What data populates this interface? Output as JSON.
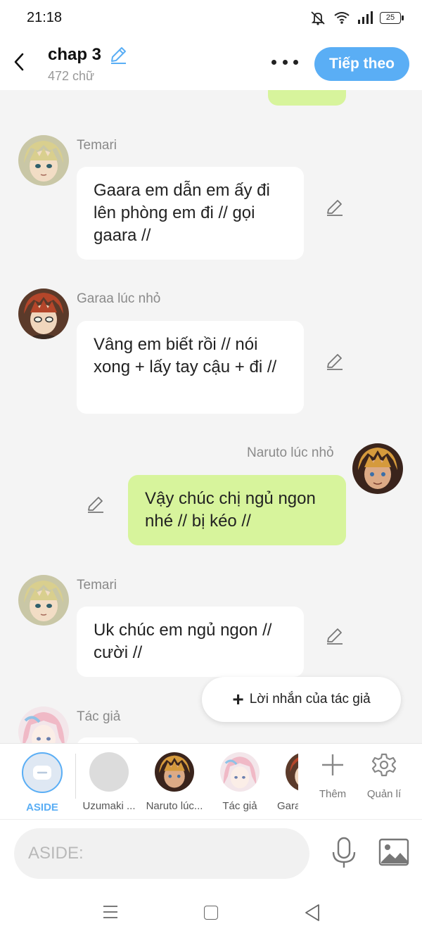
{
  "status": {
    "time": "21:18",
    "battery": "25",
    "icons": [
      "mute-icon",
      "wifi-icon",
      "signal-icon",
      "battery-icon"
    ]
  },
  "header": {
    "title": "chap 3",
    "word_count": "472 chữ",
    "next_label": "Tiếp theo",
    "accent_color": "#5aaef5"
  },
  "messages": [
    {
      "sender": "Temari",
      "side": "left",
      "text": "Gaara em dẫn em ấy đi lên phòng em đi // gọi gaara //"
    },
    {
      "sender": "Garaa lúc nhỏ",
      "side": "left",
      "text": "Vâng em biết rồi // nói xong + lấy tay cậu + đi //"
    },
    {
      "sender": "Naruto lúc nhỏ",
      "side": "right",
      "text": "Vậy chúc chị ngủ ngon nhé // bị kéo //"
    },
    {
      "sender": "Temari",
      "side": "left",
      "text": "Uk chúc em ngủ ngon // cười //"
    },
    {
      "sender": "Tác giả",
      "side": "left",
      "text": ""
    }
  ],
  "author_note": {
    "label": "Lời nhắn của tác giả"
  },
  "characters": [
    {
      "label": "ASIDE",
      "active": true
    },
    {
      "label": "Uzumaki ..."
    },
    {
      "label": "Naruto lúc..."
    },
    {
      "label": "Tác giả"
    },
    {
      "label": "Gara"
    }
  ],
  "tools": {
    "add_label": "Thêm",
    "manage_label": "Quản lí"
  },
  "input": {
    "placeholder": "ASIDE:",
    "value": ""
  },
  "colors": {
    "bubble_self": "#d7f49c",
    "bubble_other": "#ffffff",
    "background": "#f4f4f4"
  }
}
